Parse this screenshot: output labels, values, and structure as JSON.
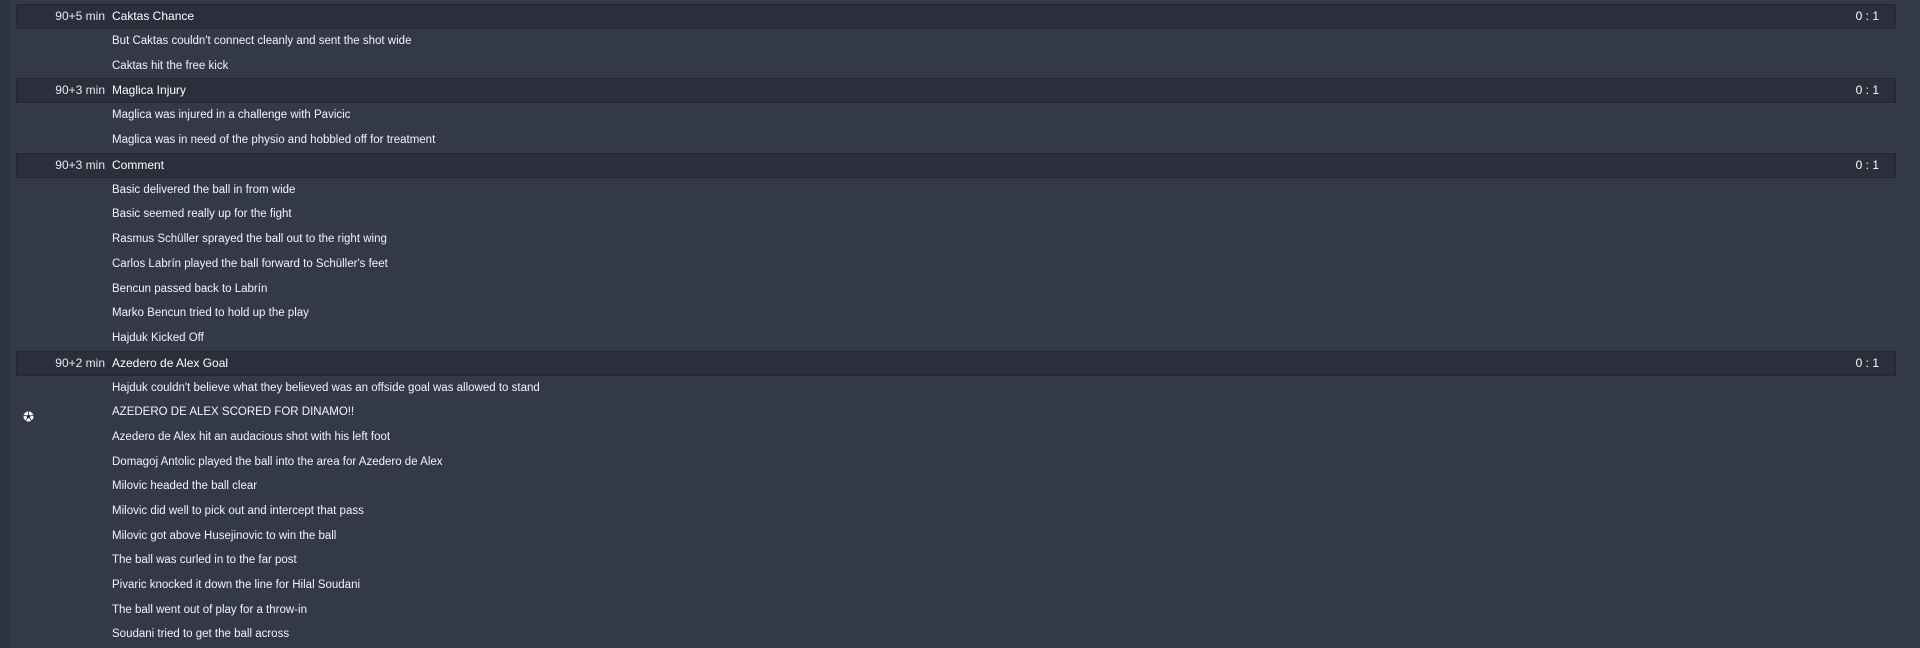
{
  "events": [
    {
      "minute": "90+5 min",
      "title": "Caktas Chance",
      "score": "0 : 1",
      "lines": [
        {
          "text": "But Caktas couldn't connect cleanly and sent the shot wide"
        },
        {
          "text": "Caktas hit the free kick"
        }
      ]
    },
    {
      "minute": "90+3 min",
      "title": "Maglica Injury",
      "score": "0 : 1",
      "lines": [
        {
          "text": "Maglica was injured in a challenge with Pavicic"
        },
        {
          "text": "Maglica was in need of the physio and hobbled off for treatment"
        }
      ]
    },
    {
      "minute": "90+3 min",
      "title": "Comment",
      "score": "0 : 1",
      "lines": [
        {
          "text": "Basic delivered the ball in from wide"
        },
        {
          "text": "Basic seemed really up for the fight"
        },
        {
          "text": "Rasmus Schüller sprayed the ball out to the right wing"
        },
        {
          "text": "Carlos Labrín played the ball forward to Schüller's feet"
        },
        {
          "text": "Bencun passed back to Labrín"
        },
        {
          "text": "Marko Bencun tried to hold up the play"
        },
        {
          "text": "Hajduk Kicked Off"
        }
      ]
    },
    {
      "minute": "90+2 min",
      "title": "Azedero de Alex Goal",
      "score": "0 : 1",
      "lines": [
        {
          "text": "Hajduk couldn't believe what they believed was an offside goal was allowed to stand"
        },
        {
          "text": "AZEDERO DE ALEX SCORED FOR DINAMO!!",
          "icon": "soccer-ball-icon"
        },
        {
          "text": "Azedero de Alex hit an audacious shot with his left foot"
        },
        {
          "text": "Domagoj Antolic played the ball into the area for Azedero de Alex"
        },
        {
          "text": "Milovic headed the ball clear"
        },
        {
          "text": "Milovic did well to pick out and intercept that pass"
        },
        {
          "text": "Milovic got above Husejinovic to win the ball"
        },
        {
          "text": "The ball was curled in to the far post"
        },
        {
          "text": "Pivaric knocked it down the line for Hilal Soudani"
        },
        {
          "text": "The ball went out of play for a throw-in"
        },
        {
          "text": "Soudani tried to get the ball across"
        }
      ]
    }
  ]
}
